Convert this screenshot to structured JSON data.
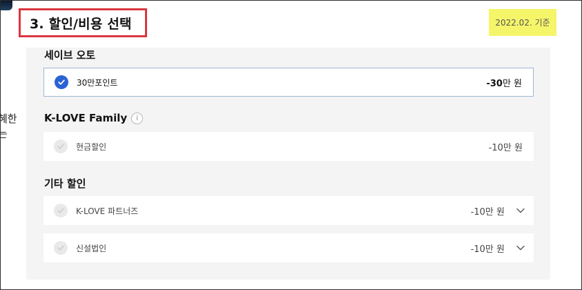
{
  "header": {
    "section_title": "3. 할인/비용 선택",
    "date_note": "2022.02. 기준"
  },
  "cutoff_text": {
    "line1": "혜한",
    "line2": "는"
  },
  "groups": [
    {
      "title": "세이브 오토",
      "options": [
        {
          "label": "30만포인트",
          "amount_num": "-30",
          "amount_unit": "만 원",
          "checked": true
        }
      ]
    },
    {
      "title": "K-LOVE Family",
      "info_icon": "i",
      "options": [
        {
          "label": "현금할인",
          "amount": "-10만 원",
          "checked": false
        }
      ]
    },
    {
      "title": "기타 할인",
      "options": [
        {
          "label": "K-LOVE 파트너즈",
          "amount": "-10만 원",
          "checked": false,
          "expandable": true
        },
        {
          "label": "신설법인",
          "amount": "-10만 원",
          "checked": false,
          "expandable": true
        }
      ]
    }
  ],
  "colors": {
    "accent": "#2a63d4",
    "highlight": "#f5f56a",
    "title_border": "#d9363e",
    "panel_bg": "#f4f4f4"
  },
  "icons": {
    "checked": "check-circle-icon",
    "unchecked": "check-circle-icon",
    "expand": "chevron-down-icon",
    "info": "info-icon"
  }
}
